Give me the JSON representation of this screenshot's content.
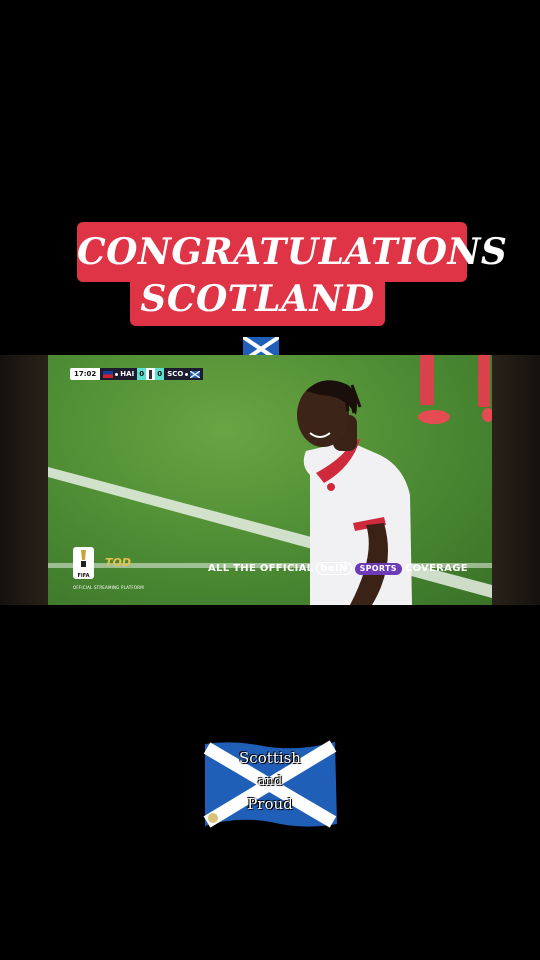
{
  "banner": {
    "line1": "CONGRATULATIONS",
    "line2": "SCOTLAND",
    "flag_icon": "scotland-flag-icon",
    "color": "#df3346"
  },
  "video": {
    "scorebug": {
      "time": "17:02",
      "home_team": "HAI",
      "home_score": "0",
      "away_score": "0",
      "away_team": "SCO",
      "score_color": "#5de0d0"
    },
    "broadcast_overlay": {
      "prefix": "ALL THE OFFICIAL",
      "network": "beIN",
      "network_suffix": "SPORTS",
      "suffix": "COVERAGE"
    },
    "fifa_badge": "FIFA",
    "streaming_logo": "TOD",
    "platform_note": "OFFICIAL STREAMING PLATFORM"
  },
  "sticker": {
    "line1": "Scottish",
    "line2": "and",
    "line3": "Proud"
  }
}
